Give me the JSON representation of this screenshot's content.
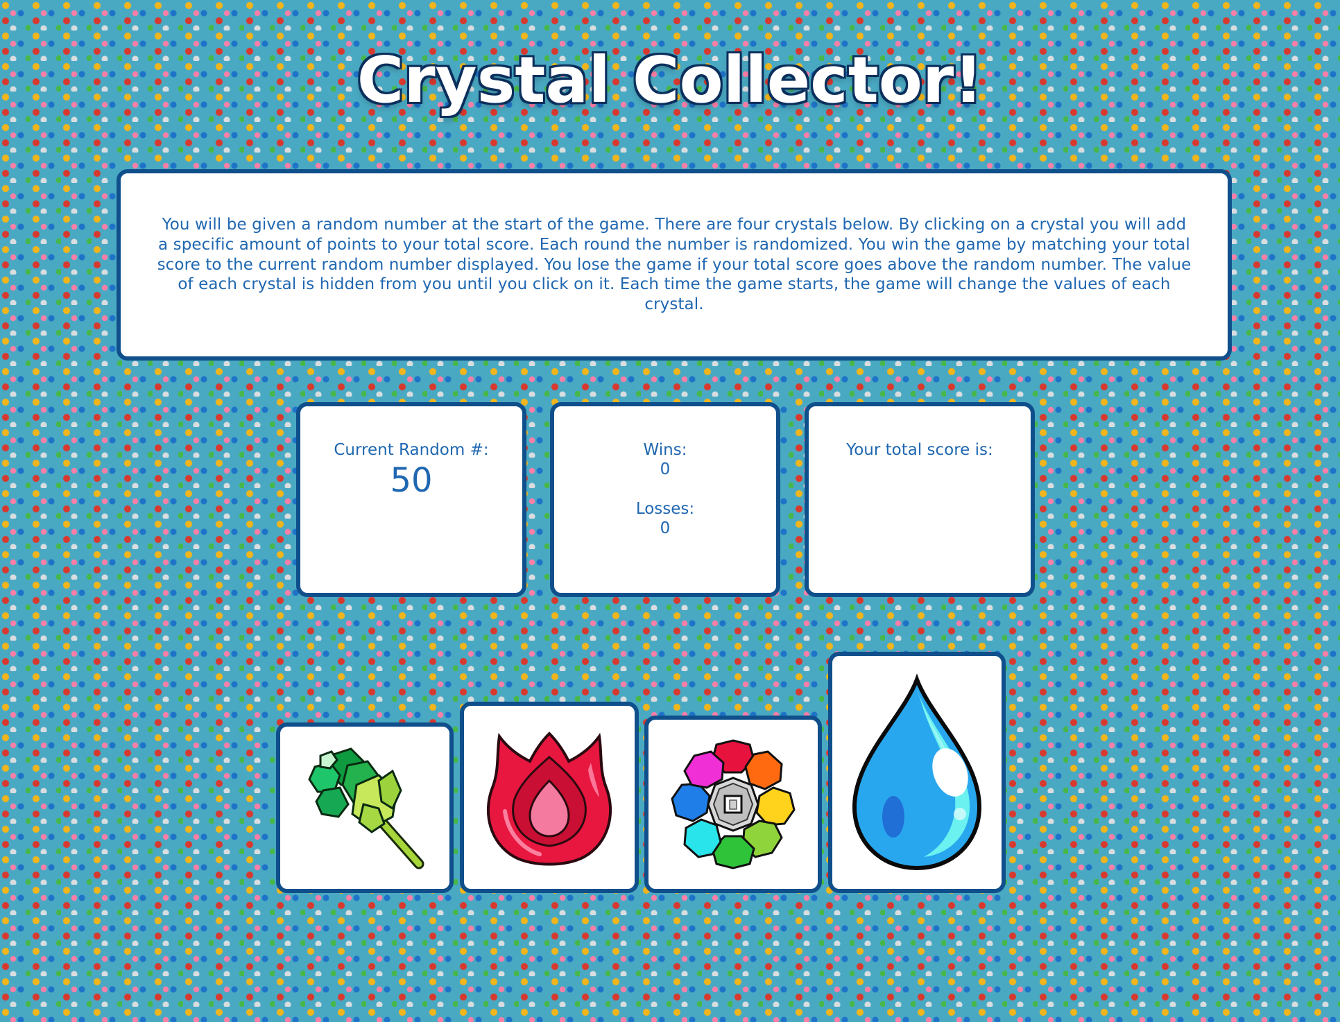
{
  "header": {
    "title": "Crystal Collector!"
  },
  "instructions": {
    "text": "You will be given a random number at the start of the game. There are four crystals below. By clicking on a crystal you will add a specific amount of points to your total score. Each round the number is randomized. You win the game by matching your total score to the current random number displayed. You lose the game if your total score goes above the random number. The value of each crystal is hidden from you until you click on it. Each time the game starts, the game will change the values of each crystal."
  },
  "stats": {
    "random_label": "Current Random #:",
    "random_value": "50",
    "wins_label": "Wins:",
    "wins_value": "0",
    "losses_label": "Losses:",
    "losses_value": "0",
    "score_label": "Your total score is:",
    "score_value": ""
  },
  "crystals": [
    {
      "icon": "green-crystal-icon"
    },
    {
      "icon": "red-crystal-icon"
    },
    {
      "icon": "rainbow-crystal-icon"
    },
    {
      "icon": "blue-crystal-icon"
    }
  ],
  "colors": {
    "background": "#4aa9c2",
    "card_border": "#0f4f8b",
    "text": "#1f67b1",
    "title": "#ffffff"
  }
}
